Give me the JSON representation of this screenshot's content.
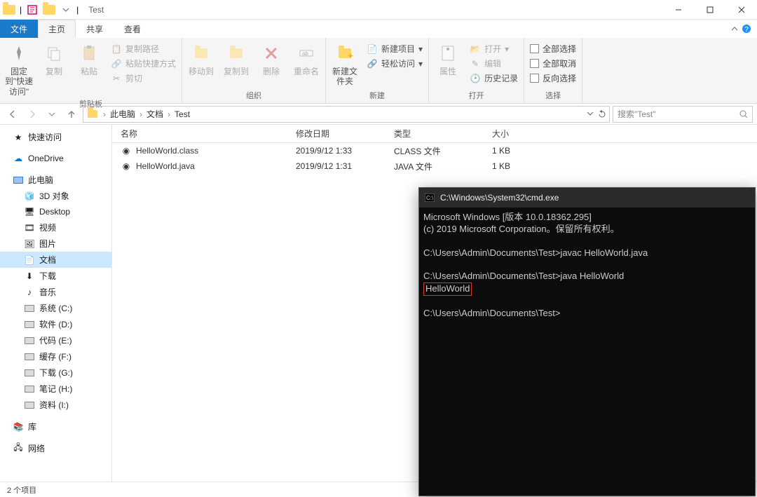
{
  "window": {
    "title": "Test"
  },
  "qat": {
    "divider": "|"
  },
  "tabs": {
    "file": "文件",
    "home": "主页",
    "share": "共享",
    "view": "查看"
  },
  "ribbon": {
    "pin": "固定到\"快速访问\"",
    "copy": "复制",
    "paste": "粘贴",
    "cut": "剪切",
    "copypath": "复制路径",
    "pasteshortcut": "粘贴快捷方式",
    "clipboard_group": "剪贴板",
    "moveto": "移动到",
    "copyto": "复制到",
    "delete": "删除",
    "rename": "重命名",
    "organize_group": "组织",
    "newfolder": "新建文件夹",
    "newitem": "新建项目",
    "easyaccess": "轻松访问",
    "new_group": "新建",
    "properties": "属性",
    "open": "打开",
    "edit": "编辑",
    "history": "历史记录",
    "open_group": "打开",
    "selectall": "全部选择",
    "selectnone": "全部取消",
    "invert": "反向选择",
    "select_group": "选择"
  },
  "breadcrumb": {
    "seg1": "此电脑",
    "seg2": "文档",
    "seg3": "Test"
  },
  "search": {
    "placeholder": "搜索\"Test\""
  },
  "columns": {
    "name": "名称",
    "date": "修改日期",
    "type": "类型",
    "size": "大小"
  },
  "files": [
    {
      "name": "HelloWorld.class",
      "date": "2019/9/12 1:33",
      "type": "CLASS 文件",
      "size": "1 KB"
    },
    {
      "name": "HelloWorld.java",
      "date": "2019/9/12 1:31",
      "type": "JAVA 文件",
      "size": "1 KB"
    }
  ],
  "sidebar": {
    "quick": "快速访问",
    "onedrive": "OneDrive",
    "thispc": "此电脑",
    "items": [
      "3D 对象",
      "Desktop",
      "视频",
      "图片",
      "文档",
      "下载",
      "音乐",
      "系统 (C:)",
      "软件 (D:)",
      "代码 (E:)",
      "缓存 (F:)",
      "下载 (G:)",
      "笔记 (H:)",
      "资料 (I:)"
    ],
    "libraries": "库",
    "network": "网络"
  },
  "status": "2 个项目",
  "cmd": {
    "title": "C:\\Windows\\System32\\cmd.exe",
    "line1": "Microsoft Windows [版本 10.0.18362.295]",
    "line2": "(c) 2019 Microsoft Corporation。保留所有权利。",
    "prompt1": "C:\\Users\\Admin\\Documents\\Test>javac HelloWorld.java",
    "prompt2": "C:\\Users\\Admin\\Documents\\Test>java HelloWorld",
    "output": "HelloWorld",
    "prompt3": "C:\\Users\\Admin\\Documents\\Test>"
  }
}
